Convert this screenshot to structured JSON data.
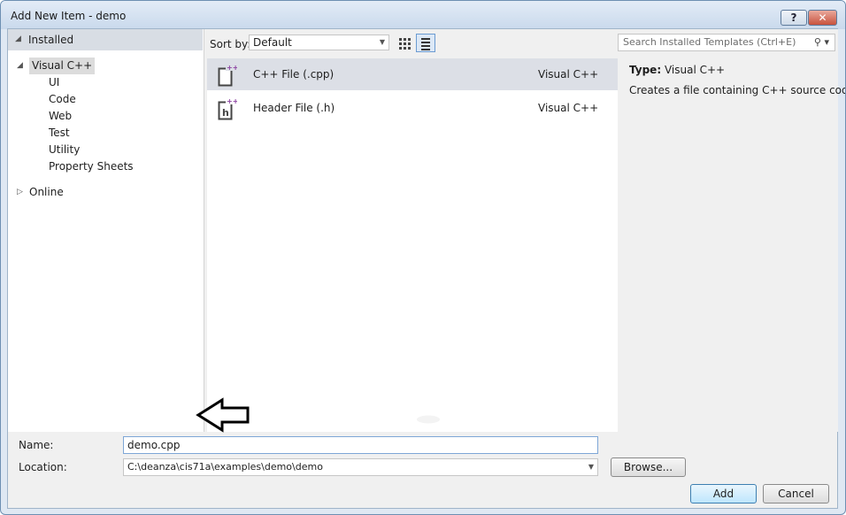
{
  "window": {
    "title": "Add New Item - demo",
    "help_label": "?",
    "close_label": "✕"
  },
  "left": {
    "installed_label": "Installed",
    "tree": [
      {
        "label": "Visual C++",
        "level": 0,
        "expanded": true,
        "selected": true
      },
      {
        "label": "UI",
        "level": 1
      },
      {
        "label": "Code",
        "level": 1
      },
      {
        "label": "Web",
        "level": 1
      },
      {
        "label": "Test",
        "level": 1
      },
      {
        "label": "Utility",
        "level": 1
      },
      {
        "label": "Property Sheets",
        "level": 1
      }
    ],
    "online_label": "Online"
  },
  "toolbar": {
    "sort_label": "Sort by:",
    "sort_value": "Default"
  },
  "items": [
    {
      "name": "C++ File (.cpp)",
      "lang": "Visual C++",
      "icon": "cpp-file-icon",
      "selected": true
    },
    {
      "name": "Header File (.h)",
      "lang": "Visual C++",
      "icon": "header-file-icon",
      "selected": false
    }
  ],
  "right": {
    "search_placeholder": "Search Installed Templates (Ctrl+E)",
    "type_key": "Type:",
    "type_value": "Visual C++",
    "description": "Creates a file containing C++ source code"
  },
  "bottom": {
    "name_label": "Name:",
    "name_value": "demo.cpp",
    "location_label": "Location:",
    "location_value": "C:\\deanza\\cis71a\\examples\\demo\\demo",
    "browse_label": "Browse...",
    "add_label": "Add",
    "cancel_label": "Cancel"
  },
  "colors": {
    "selection": "#dcdfe6",
    "accent": "#7ea6d6",
    "close": "#c8523d"
  }
}
